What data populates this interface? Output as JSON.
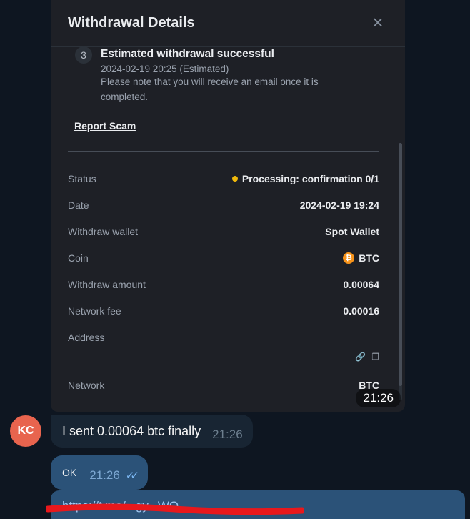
{
  "panel": {
    "title": "Withdrawal Details",
    "close_icon": "close-icon",
    "step": {
      "number": "3",
      "title": "Estimated withdrawal successful",
      "date": "2024-02-19 20:25 (Estimated)",
      "note": "Please note that you will receive an email once it is completed."
    },
    "report_scam": "Report Scam",
    "details": {
      "status_label": "Status",
      "status_value": "Processing: confirmation 0/1",
      "date_label": "Date",
      "date_value": "2024-02-19 19:24",
      "wallet_label": "Withdraw wallet",
      "wallet_value": "Spot Wallet",
      "coin_label": "Coin",
      "coin_value": "BTC",
      "amount_label": "Withdraw amount",
      "amount_value": "0.00064",
      "fee_label": "Network fee",
      "fee_value": "0.00016",
      "address_label": "Address",
      "network_label": "Network",
      "network_value": "BTC"
    },
    "status_color": "#f0b90b",
    "image_time": "21:26"
  },
  "messages": [
    {
      "avatar_initials": "KC",
      "text": "I sent 0.00064 btc finally",
      "time": "21:26"
    },
    {
      "text": "OK",
      "time": "21:26"
    }
  ],
  "link_message": {
    "text": "https://t.me/...gy...WQ"
  }
}
